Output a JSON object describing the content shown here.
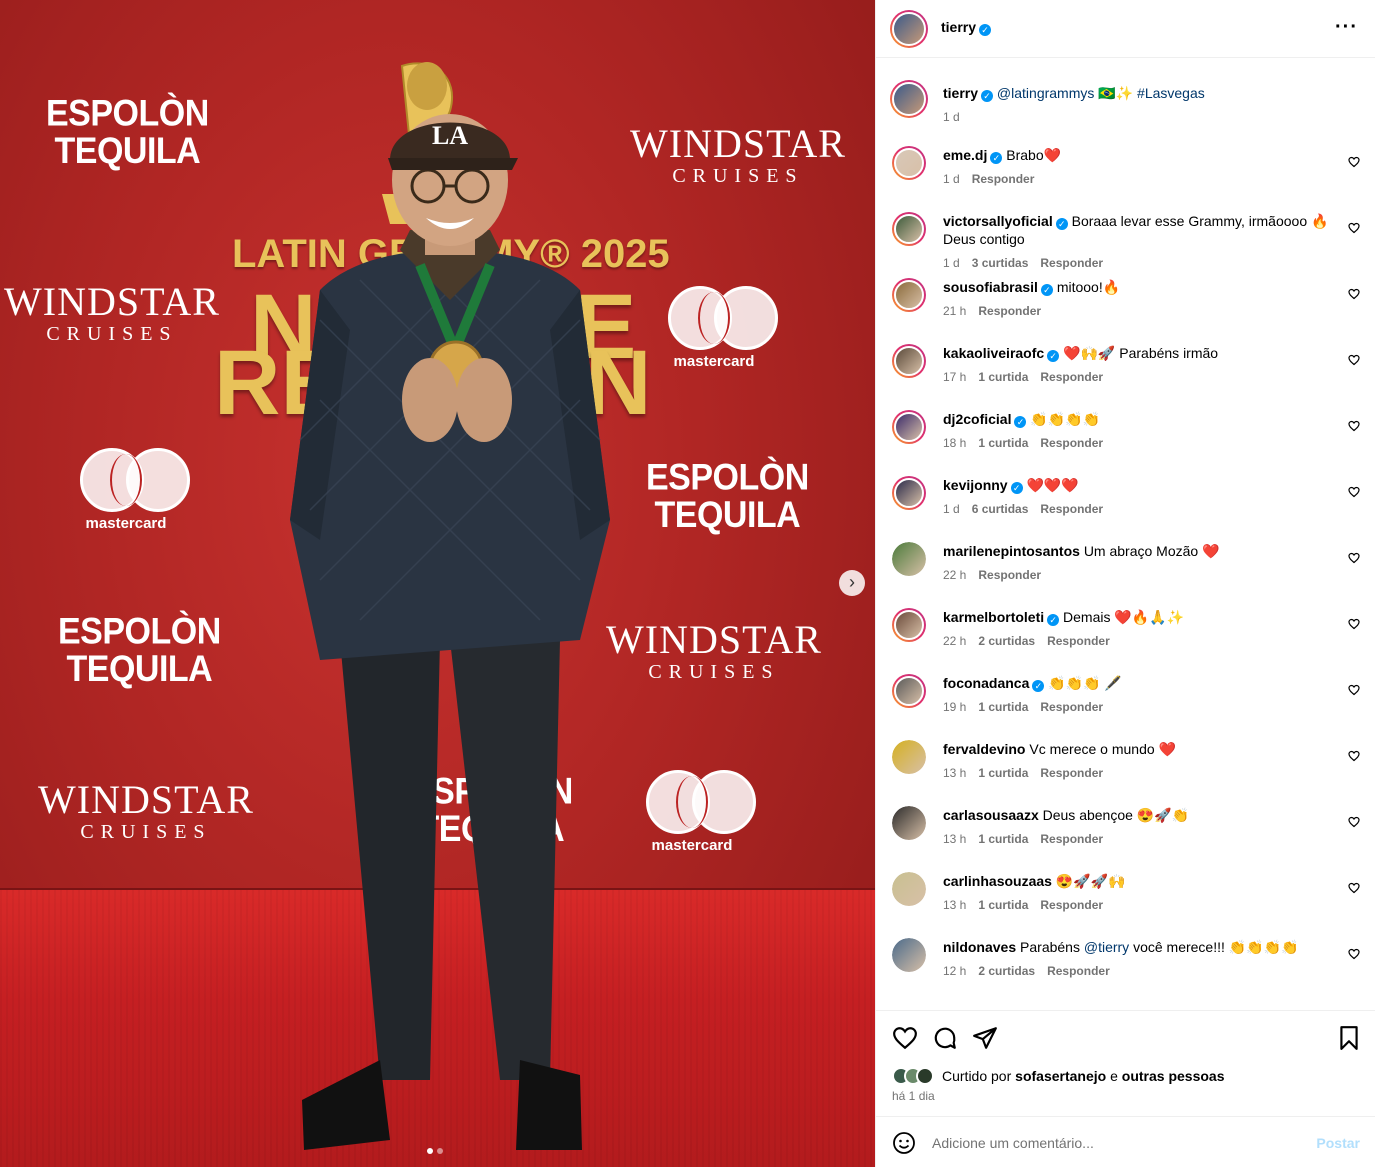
{
  "post": {
    "username": "tierry",
    "caption_mention": "@latingrammys",
    "caption_emoji": "🇧🇷✨",
    "caption_hashtag": "#Lasvegas",
    "caption_time": "1 d"
  },
  "photo": {
    "grammy_title": "LATIN GRAMMY® 2025",
    "grammy_big_line1": "NO",
    "grammy_big_line1b": "E",
    "grammy_big_line2": "RE",
    "grammy_big_line2b": "N",
    "espolon_1": "ESPOLÒN",
    "espolon_2": "TEQUILA",
    "windstar_1": "WINDSTAR",
    "windstar_2": "CRUISES",
    "mastercard": "mastercard",
    "cap_text": "LA",
    "carousel_next": "›"
  },
  "comments": [
    {
      "user": "eme.dj",
      "verified": true,
      "text": "Brabo❤️",
      "time": "1 d",
      "likes": "",
      "reply": "Responder",
      "color": "#d8c8b8"
    },
    {
      "user": "victorsallyoficial",
      "verified": true,
      "text": "Boraaa levar esse Grammy, irmãoooo 🔥 Deus contigo",
      "time": "1 d",
      "likes": "3 curtidas",
      "reply": "Responder",
      "color": "#3c5a3a"
    },
    {
      "user": "sousofiabrasil",
      "verified": true,
      "text": "mitooo!🔥",
      "time": "21 h",
      "likes": "",
      "reply": "Responder",
      "color": "#8a6a3a"
    },
    {
      "user": "kakaoliveiraofc",
      "verified": true,
      "text": "❤️🙌🚀 Parabéns irmão",
      "time": "17 h",
      "likes": "1 curtida",
      "reply": "Responder",
      "color": "#5a4a3a"
    },
    {
      "user": "dj2coficial",
      "verified": true,
      "text": "👏👏👏👏",
      "time": "18 h",
      "likes": "1 curtida",
      "reply": "Responder",
      "color": "#3a2a6a"
    },
    {
      "user": "kevijonny",
      "verified": true,
      "text": "❤️❤️❤️",
      "time": "1 d",
      "likes": "6 curtidas",
      "reply": "Responder",
      "color": "#2a2a4a"
    },
    {
      "user": "marilenepintosantos",
      "verified": false,
      "text": "Um abraço Mozão ❤️",
      "time": "22 h",
      "likes": "",
      "reply": "Responder",
      "color": "#4a7a3a"
    },
    {
      "user": "karmelbortoleti",
      "verified": true,
      "text": "Demais ❤️🔥🙏✨",
      "time": "22 h",
      "likes": "2 curtidas",
      "reply": "Responder",
      "color": "#6a4a3a"
    },
    {
      "user": "foconadanca",
      "verified": true,
      "text": "👏👏👏 🖋️",
      "time": "19 h",
      "likes": "1 curtida",
      "reply": "Responder",
      "color": "#5a5a5a"
    },
    {
      "user": "fervaldevino",
      "verified": false,
      "text": "Vc merece o mundo ❤️",
      "time": "13 h",
      "likes": "1 curtida",
      "reply": "Responder",
      "color": "#d4b020"
    },
    {
      "user": "carlasousaazx",
      "verified": false,
      "text": "Deus abençoe 😍🚀👏",
      "time": "13 h",
      "likes": "1 curtida",
      "reply": "Responder",
      "color": "#2a2a2a"
    },
    {
      "user": "carlinhasouzaas",
      "verified": false,
      "text": "😍🚀🚀🙌",
      "time": "13 h",
      "likes": "1 curtida",
      "reply": "Responder",
      "color": "#c8c090"
    },
    {
      "user": "nildonaves",
      "verified": false,
      "text_pre": "Parabéns ",
      "mention": "@tierry",
      "text": " você merece!!! 👏👏👏👏",
      "time": "12 h",
      "likes": "2 curtidas",
      "reply": "Responder",
      "color": "#4a6a8a"
    }
  ],
  "actions": {
    "liked_by_prefix": "Curtido por",
    "liked_by_user": "sofasertanejo",
    "liked_by_and": "e",
    "liked_by_others": "outras pessoas",
    "ago": "há 1 dia"
  },
  "add_comment": {
    "placeholder": "Adicione um comentário...",
    "post_label": "Postar"
  },
  "colors": {
    "verified": "#0095f6",
    "link": "#00376b",
    "muted": "#737373",
    "post_disabled": "#b2dffc",
    "backdrop_red": "#b02624",
    "gold": "#e8c25a"
  }
}
